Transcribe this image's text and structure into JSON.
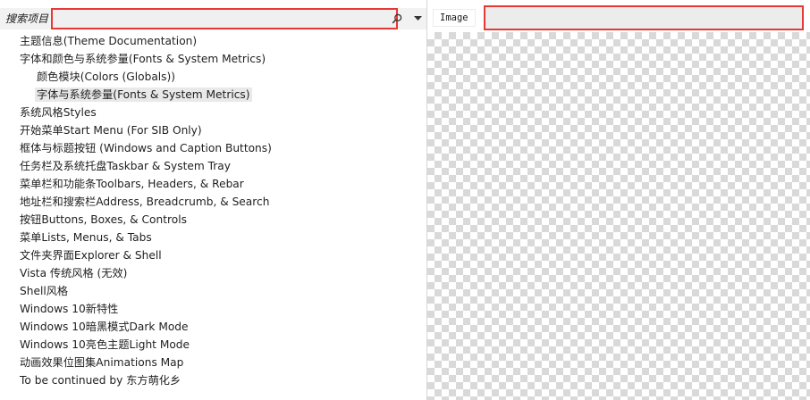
{
  "search": {
    "label": "搜索项目",
    "value": "",
    "placeholder": ""
  },
  "icons": {
    "search": "search-icon",
    "dropdown": "chevron-down-icon"
  },
  "tree": {
    "items": [
      {
        "label": "主题信息(Theme Documentation)",
        "level": 0,
        "selected": false
      },
      {
        "label": "字体和颜色与系统参量(Fonts & System Metrics)",
        "level": 0,
        "selected": false
      },
      {
        "label": "颜色模块(Colors (Globals))",
        "level": 1,
        "selected": false
      },
      {
        "label": "字体与系统参量(Fonts & System Metrics)",
        "level": 1,
        "selected": true
      },
      {
        "label": "系统风格Styles",
        "level": 0,
        "selected": false
      },
      {
        "label": "开始菜单Start Menu (For SIB Only)",
        "level": 0,
        "selected": false
      },
      {
        "label": "框体与标题按钮 (Windows and Caption Buttons)",
        "level": 0,
        "selected": false
      },
      {
        "label": "任务栏及系统托盘Taskbar & System Tray",
        "level": 0,
        "selected": false
      },
      {
        "label": "菜单栏和功能条Toolbars, Headers, & Rebar",
        "level": 0,
        "selected": false
      },
      {
        "label": "地址栏和搜索栏Address, Breadcrumb, & Search",
        "level": 0,
        "selected": false
      },
      {
        "label": "按钮Buttons, Boxes, & Controls",
        "level": 0,
        "selected": false
      },
      {
        "label": "菜单Lists, Menus, & Tabs",
        "level": 0,
        "selected": false
      },
      {
        "label": "文件夹界面Explorer & Shell",
        "level": 0,
        "selected": false
      },
      {
        "label": "Vista 传统风格 (无效)",
        "level": 0,
        "selected": false
      },
      {
        "label": "Shell风格",
        "level": 0,
        "selected": false
      },
      {
        "label": "Windows 10新特性",
        "level": 0,
        "selected": false
      },
      {
        "label": "Windows 10暗黑模式Dark Mode",
        "level": 0,
        "selected": false
      },
      {
        "label": "Windows 10亮色主题Light Mode",
        "level": 0,
        "selected": false
      },
      {
        "label": "动画效果位图集Animations Map",
        "level": 0,
        "selected": false
      },
      {
        "label": "To be continued by 东方萌化乡",
        "level": 0,
        "selected": false
      }
    ]
  },
  "preview": {
    "tab_label": "Image",
    "field_value": ""
  },
  "colors": {
    "highlight_border": "#e53935",
    "selected_row": "#e9e9e9",
    "checker_dark": "#d9d9d9",
    "checker_light": "#ffffff"
  }
}
